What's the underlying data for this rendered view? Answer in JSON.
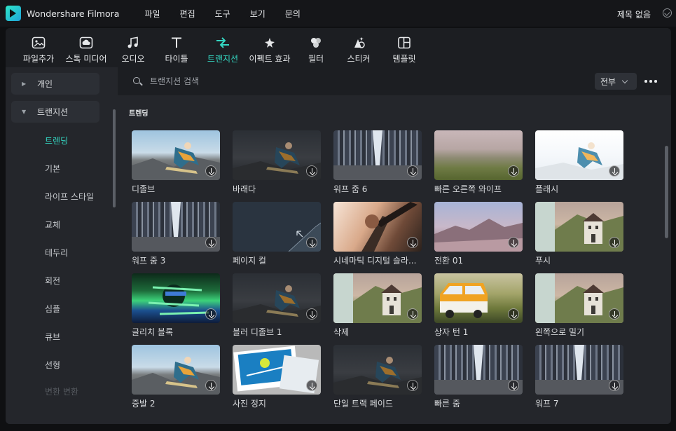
{
  "app": {
    "title": "Wondershare Filmora"
  },
  "menu": [
    "파일",
    "편집",
    "도구",
    "보기",
    "문의"
  ],
  "project": {
    "title": "제목 없음"
  },
  "toolbar": [
    {
      "label": "파일추가",
      "icon": "import-media-icon"
    },
    {
      "label": "스톡 미디어",
      "icon": "stock-media-icon"
    },
    {
      "label": "오디오",
      "icon": "music-note-icon"
    },
    {
      "label": "타이틀",
      "icon": "title-t-icon"
    },
    {
      "label": "트랜지션",
      "icon": "transition-arrows-icon",
      "active": true
    },
    {
      "label": "이펙트 효과",
      "icon": "effects-sparkle-icon"
    },
    {
      "label": "필터",
      "icon": "filter-circles-icon"
    },
    {
      "label": "스티커",
      "icon": "sticker-icon"
    },
    {
      "label": "템플릿",
      "icon": "template-grid-icon"
    }
  ],
  "sidebar": {
    "personal": "개인",
    "transitions": "트랜지션",
    "items": [
      "트렌딩",
      "기본",
      "라이프 스타일",
      "교체",
      "테두리",
      "회전",
      "심플",
      "큐브",
      "선형",
      "변환 변환"
    ]
  },
  "search": {
    "placeholder": "트랜지션 검색"
  },
  "filter": {
    "selected": "전부"
  },
  "section": {
    "title": "트렌딩"
  },
  "colors": {
    "accent": "#34d8c3",
    "background": "#1c1e22",
    "sidebar": "#24262b"
  },
  "transitions": [
    {
      "label": "디졸브",
      "thumb": "sky"
    },
    {
      "label": "바래다",
      "thumb": "dark"
    },
    {
      "label": "워프 줌 6",
      "thumb": "city"
    },
    {
      "label": "빠른 오른쪽 와이프",
      "thumb": "blurgreen"
    },
    {
      "label": "플래시",
      "thumb": "white"
    },
    {
      "label": "워프 줌 3",
      "thumb": "city"
    },
    {
      "label": "페이지 컬",
      "thumb": "page"
    },
    {
      "label": "시네마틱 디지털 슬라...",
      "thumb": "cine"
    },
    {
      "label": "전환 01",
      "thumb": "mountain"
    },
    {
      "label": "푸시",
      "thumb": "house"
    },
    {
      "label": "글리치 블록",
      "thumb": "glitch"
    },
    {
      "label": "블러 디졸브 1",
      "thumb": "dark"
    },
    {
      "label": "삭제",
      "thumb": "house"
    },
    {
      "label": "상자 턴 1",
      "thumb": "van"
    },
    {
      "label": "왼쪽으로 밀기",
      "thumb": "house"
    },
    {
      "label": "증발 2",
      "thumb": "sky"
    },
    {
      "label": "사진 정지",
      "thumb": "photo"
    },
    {
      "label": "단일 트랙 페이드",
      "thumb": "dark"
    },
    {
      "label": "빠른 줌",
      "thumb": "city"
    },
    {
      "label": "워프 7",
      "thumb": "city"
    }
  ]
}
